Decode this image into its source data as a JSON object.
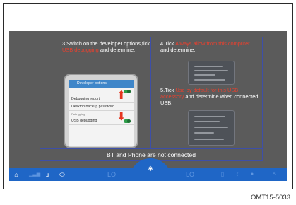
{
  "guide": {
    "step3": {
      "prefix": "3.Switch on the developer options,tick ",
      "highlight": "USB debugging",
      "suffix": " and determine."
    },
    "step4": {
      "prefix": "4.Tick ",
      "highlight": "Always allow from this computer",
      "suffix": " and determine."
    },
    "step5": {
      "prefix": "5.Tick ",
      "highlight": "Use by default for this USB accessory",
      "suffix": " and determine when connected USB."
    }
  },
  "phone": {
    "title": "Developer options",
    "rows": [
      "Debugging report",
      "Desktop backup password",
      "Debugging",
      "USB debugging"
    ]
  },
  "status": {
    "message": "BT and Phone are not connected"
  },
  "pager": {
    "count": 2,
    "active": 2
  },
  "bottom_bar": {
    "lo_left": "LO",
    "lo_right": "LO"
  },
  "caption": "OMT15-5033",
  "colors": {
    "highlight": "#e8412f",
    "bar": "#1f66c6",
    "screen": "#5b5b5b",
    "frame": "#3d4fa8"
  },
  "icons": [
    "home-icon",
    "signal-icon",
    "seat-icon",
    "car-icon",
    "climate-icon",
    "phone-icon",
    "bluetooth-icon",
    "mic-icon",
    "user-icon"
  ]
}
